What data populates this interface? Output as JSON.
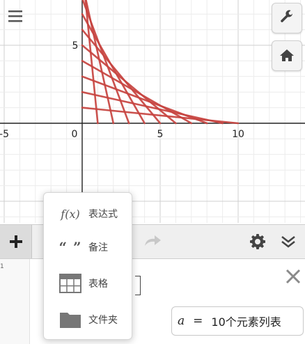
{
  "graph": {
    "x_ticks": [
      "-5",
      "0",
      "5",
      "10"
    ],
    "y_ticks": [
      "5"
    ],
    "curve_color": "#c74440",
    "segment_count": 10,
    "segment_max": 10
  },
  "toolbar": {
    "add_icon": "plus-icon",
    "redo_icon": "redo-icon",
    "settings_icon": "gear-icon",
    "collapse_icon": "double-chevron-down-icon"
  },
  "add_menu": {
    "items": [
      {
        "icon": "fx-icon",
        "label": "表达式",
        "glyph": "f(x)"
      },
      {
        "icon": "quote-icon",
        "label": "备注",
        "glyph": "“ ”"
      },
      {
        "icon": "table-icon",
        "label": "表格"
      },
      {
        "icon": "folder-icon",
        "label": "文件夹"
      }
    ]
  },
  "expression": {
    "index": "1",
    "tooltip_var": "a",
    "tooltip_eq": "=",
    "tooltip_desc": "10个元素列表"
  },
  "corner_buttons": {
    "settings_icon": "wrench-icon",
    "home_icon": "home-icon",
    "menu_icon": "hamburger-menu-icon"
  }
}
